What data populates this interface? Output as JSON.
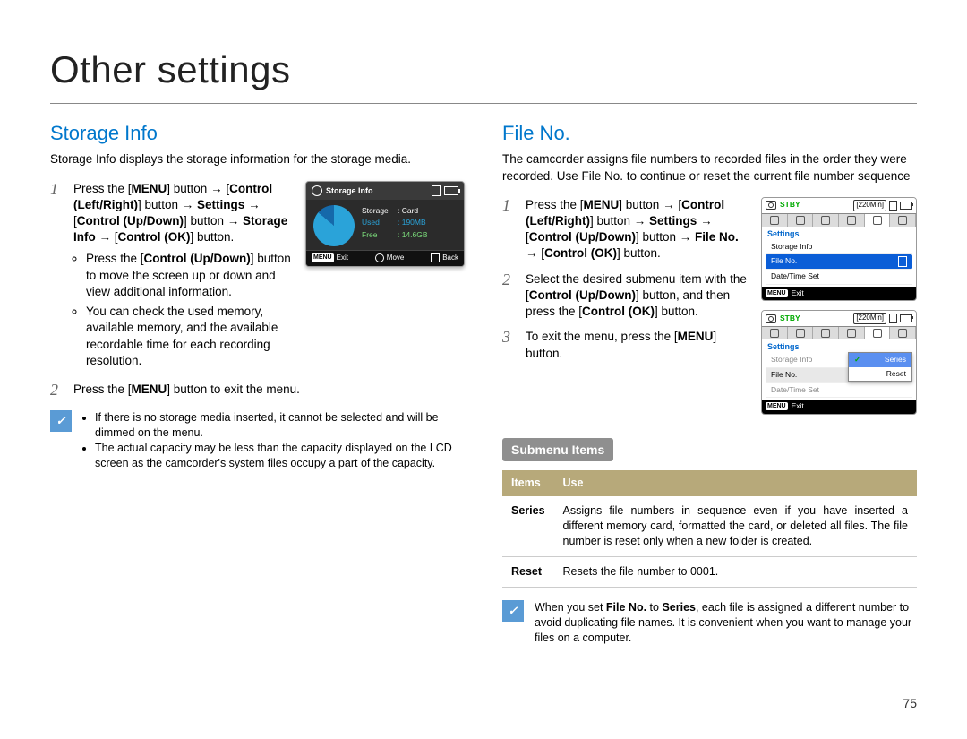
{
  "page_title": "Other settings",
  "page_number": "75",
  "left": {
    "section_title": "Storage Info",
    "intro": "Storage Info displays the storage information for the storage media.",
    "step1": {
      "press_the": "Press the [",
      "menu": "MENU",
      "closing": "] button ",
      "ctrl_lr": "Control (Left/Right)",
      "btn_txt": "] button ",
      "settings": "Settings",
      "control_ud": "Control (Up/Down)",
      "storage_info": "Storage Info",
      "control_ok": "Control (OK)",
      "end": "] button."
    },
    "step1_bullets": [
      "Press the [Control (Up/Down)] button to move the screen up or down and view additional information.",
      "You can check the used memory, available memory, and the available recordable time for each recording resolution."
    ],
    "step2": "Press the [MENU] button to exit the menu.",
    "notes": [
      "If there is no storage media inserted, it cannot be selected and will be dimmed on the menu.",
      "The actual capacity may be less than the capacity displayed on the LCD screen as the camcorder's system files occupy a part of the capacity."
    ],
    "lcd": {
      "title": "Storage Info",
      "storage_k": "Storage",
      "storage_v": ": Card",
      "used_k": "Used",
      "used_v": ": 190MB",
      "free_k": "Free",
      "free_v": ": 14.6GB",
      "exit": "Exit",
      "move": "Move",
      "back": "Back",
      "menu_chip": "MENU"
    }
  },
  "right": {
    "section_title": "File No.",
    "intro": "The camcorder assigns file numbers to recorded files in the order they were recorded. Use File No. to continue or reset the current file number sequence",
    "step1": {
      "press_the": "Press the [",
      "menu": "MENU",
      "closing": "] button ",
      "ctrl_lr": "Control (Left/Right)",
      "btn_txt": "] button ",
      "settings": "Settings",
      "control_ud": "Control (Up/Down)",
      "file_no": "File No.",
      "control_ok": "Control (OK)",
      "end": "] button."
    },
    "step2_a": "Select the desired submenu item with the [",
    "step2_b": "Control (Up/Down)",
    "step2_c": "] button, and then press the [",
    "step2_d": "Control (OK)",
    "step2_e": "] button.",
    "step3_a": "To exit the menu, press the [",
    "step3_b": "MENU",
    "step3_c": "] button.",
    "lcd1": {
      "stby": "STBY",
      "time": "[220Min]",
      "section": "Settings",
      "items": [
        "Storage Info",
        "File No.",
        "Date/Time Set"
      ],
      "exit": "Exit",
      "menu_chip": "MENU"
    },
    "lcd2": {
      "stby": "STBY",
      "time": "[220Min]",
      "section": "Settings",
      "items": [
        "Storage Info",
        "File No.",
        "Date/Time Set"
      ],
      "popup": [
        "Series",
        "Reset"
      ],
      "exit": "Exit",
      "menu_chip": "MENU"
    },
    "submenu_heading": "Submenu Items",
    "table": {
      "h_items": "Items",
      "h_use": "Use",
      "rows": [
        {
          "item": "Series",
          "use": "Assigns file numbers in sequence even if you have inserted a different memory card, formatted the card, or deleted all files. The file number is reset only when a new folder is created."
        },
        {
          "item": "Reset",
          "use": "Resets the file number to 0001."
        }
      ]
    },
    "note_a": "When you set ",
    "note_b": "File No.",
    "note_c": " to ",
    "note_d": "Series",
    "note_e": ", each file is assigned a different number to avoid duplicating file names. It is convenient when you want to manage your files on a computer."
  }
}
